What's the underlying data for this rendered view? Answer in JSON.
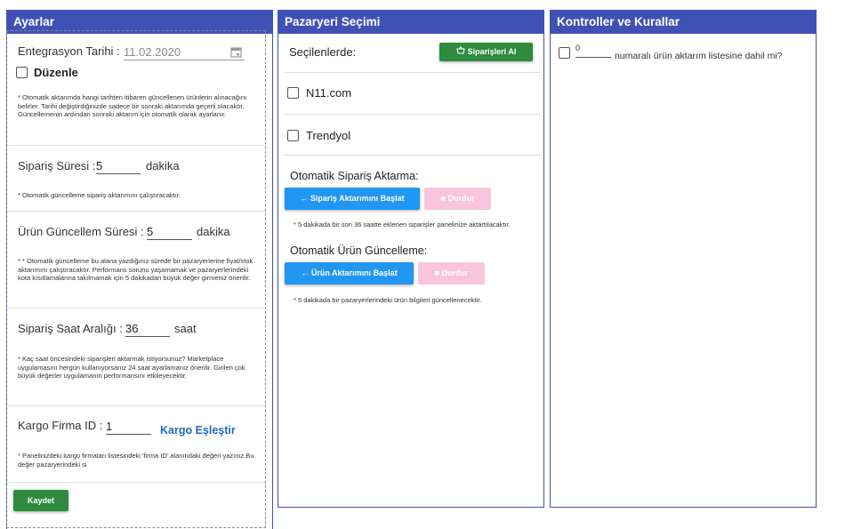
{
  "settings": {
    "title": "Ayarlar",
    "integration_date_label": "Entegrasyon Tarihi :",
    "integration_date_value": "11.02.2020",
    "edit_label": "Düzenle",
    "integration_note": "* Otomatik aktarımda hangi tarihten itibaren güncellenen ürünlerin alınacağını belirler. Tarihi değiştirdiğinizde sadece bir sonraki aktarımda geçerli olacaktır. Güncellemenin ardından sonraki aktarım için otomatik olarak ayarlanır.",
    "order_interval_label": "Sipariş Süresi :",
    "order_interval_value": "5",
    "order_interval_unit": "dakika",
    "order_interval_note": "* Otomatik güncelleme sipariş aktarımını çalıştıracaktır.",
    "product_update_label": "Ürün Güncellem Süresi :",
    "product_update_value": "5",
    "product_update_unit": "dakika",
    "product_update_note": "* * Otomatik güncelleme bu alana yazdığınız sürede bir pazaryerlerine fiyat/stok aktarımını çalıştıracaktır. Performans sorunu yaşamamak ve pazaryerlerindeki kota kısıtlamalarına takılmamak için 5 dakikadan büyük değer girmeniz önerilir.",
    "order_hours_label": "Sipariş Saat Aralığı :",
    "order_hours_value": "36",
    "order_hours_unit": "saat",
    "order_hours_note": "* Kaç saat öncesindeki siparişleri aktarmak istiyorsunuz? Marketplace uygulamasını hergün kullanıyorsanız 24 saat ayarlamanız önerilir. Girilen çok büyük değerler uygulamanın performansını etkileyecektir.",
    "cargo_label": "Kargo Firma ID :",
    "cargo_value": "1",
    "cargo_match_link": "Kargo Eşleştir",
    "cargo_note": "* Panelinizdeki kargo firmaları listesindeki 'firma ID' alanındaki değeri yazınız.Bu değer pazaryerindeki si",
    "save_label": "Kaydet"
  },
  "marketplace": {
    "title": "Pazaryeri Seçimi",
    "selected_label": "Seçilenlerde:",
    "get_orders_label": "Siparişleri Al",
    "items": [
      "N11.com",
      "Trendyol"
    ],
    "auto_order_title": "Otomatik Sipariş Aktarma:",
    "start_order_label": "← Sipariş Aktarımını Başlat",
    "stop_order_label": "■ Durdur",
    "auto_order_note": "* 5 dakikada bir son 36 saatte eklenen siparişler panelinize aktartılacaktır.",
    "auto_product_title": "Otomatik Ürün Güncelleme:",
    "start_product_label": "← Ürün Aktarımını Başlat",
    "stop_product_label": "■ Durdur",
    "auto_product_note": "* 5 dakikada bir pazaryerlerindeki ürün bilgileri güncellenecektir."
  },
  "controls": {
    "title": "Kontroller ve Kurallar",
    "rule_value": "0",
    "rule_text": "numaralı ürün aktarım listesine dahil mi?"
  }
}
